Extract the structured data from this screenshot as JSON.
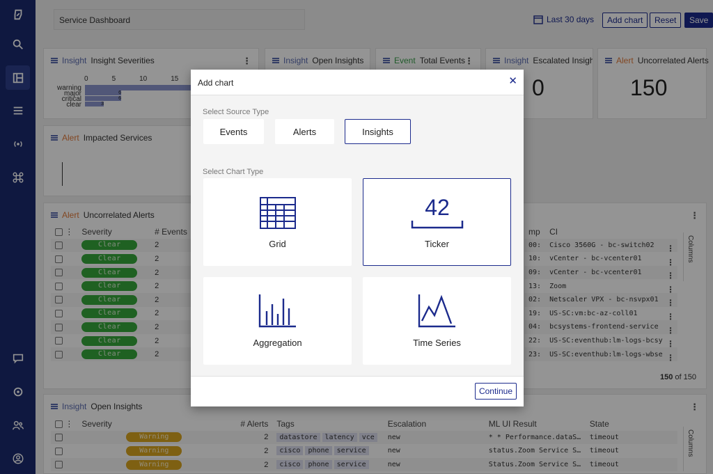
{
  "dashboard": {
    "title": "Service Dashboard",
    "date_range": "Last 30 days",
    "add_chart_label": "Add chart",
    "reset_label": "Reset",
    "save_label": "Save"
  },
  "widgets": {
    "insight_severities": {
      "tag": "Insight",
      "title": "Insight Severities",
      "ticks": [
        "0",
        "5",
        "10",
        "15"
      ],
      "bars": [
        {
          "label": "warning",
          "value": 150
        },
        {
          "label": "major",
          "value": 6
        },
        {
          "label": "critical",
          "value": 6
        },
        {
          "label": "clear",
          "value": 3
        }
      ]
    },
    "open_insights_small": {
      "tag": "Insight",
      "title": "Open Insights"
    },
    "total_events": {
      "tag": "Event",
      "title": "Total Events"
    },
    "escalated_insights": {
      "tag": "Insight",
      "title": "Escalated Insights",
      "value": "0"
    },
    "uncorrelated_small": {
      "tag": "Alert",
      "title": "Uncorrelated Alerts",
      "value": "150"
    },
    "impacted_services": {
      "tag": "Alert",
      "title": "Impacted Services"
    }
  },
  "uncorrelated_table": {
    "tag": "Alert",
    "title": "Uncorrelated Alerts",
    "headers": {
      "severity": "Severity",
      "events": "# Events",
      "timestamp": "mp",
      "ci": "CI"
    },
    "columns_label": "Columns",
    "rows": [
      {
        "severity": "Clear",
        "events": "2",
        "ts": "00:",
        "ci": "Cisco 3560G - bc-switch02"
      },
      {
        "severity": "Clear",
        "events": "2",
        "ts": "10:",
        "ci": "vCenter - bc-vcenter01"
      },
      {
        "severity": "Clear",
        "events": "2",
        "ts": "09:",
        "ci": "vCenter - bc-vcenter01"
      },
      {
        "severity": "Clear",
        "events": "2",
        "ts": "13:",
        "ci": "Zoom"
      },
      {
        "severity": "Clear",
        "events": "2",
        "ts": "02:",
        "ci": "Netscaler VPX - bc-nsvpx01"
      },
      {
        "severity": "Clear",
        "events": "2",
        "ts": "19:",
        "ci": "US-SC:vm:bc-az-coll01"
      },
      {
        "severity": "Clear",
        "events": "2",
        "ts": "04:",
        "ci": "bcsystems-frontend-service"
      },
      {
        "severity": "Clear",
        "events": "2",
        "ts": "22:",
        "ci": "US-SC:eventhub:lm-logs-bcsy"
      },
      {
        "severity": "Clear",
        "events": "2",
        "ts": "23:",
        "ci": "US-SC:eventhub:lm-logs-wbse"
      }
    ],
    "pager_bold": "150",
    "pager_rest": " of 150"
  },
  "open_insights_table": {
    "tag": "Insight",
    "title": "Open Insights",
    "headers": {
      "severity": "Severity",
      "alerts": "# Alerts",
      "tags": "Tags",
      "escalation": "Escalation",
      "ml": "ML UI Result",
      "state": "State"
    },
    "columns_label": "Columns",
    "rows": [
      {
        "severity": "Warning",
        "alerts": "2",
        "tags": [
          "datastore",
          "latency",
          "vce"
        ],
        "escalation": "new",
        "ml": "* * Performance.dataS…",
        "state": "timeout"
      },
      {
        "severity": "Warning",
        "alerts": "2",
        "tags": [
          "cisco",
          "phone",
          "service"
        ],
        "escalation": "new",
        "ml": "status.Zoom Service S…",
        "state": "timeout"
      },
      {
        "severity": "Warning",
        "alerts": "2",
        "tags": [
          "cisco",
          "phone",
          "service"
        ],
        "escalation": "new",
        "ml": "Status.Zoom Service S…",
        "state": "timeout"
      }
    ]
  },
  "modal": {
    "title": "Add chart",
    "source_label": "Select Source Type",
    "sources": [
      "Events",
      "Alerts",
      "Insights"
    ],
    "selected_source": "Insights",
    "chart_label": "Select Chart Type",
    "chart_types": [
      "Grid",
      "Ticker",
      "Aggregation",
      "Time Series"
    ],
    "selected_chart": "Ticker",
    "ticker_sample": "42",
    "continue_label": "Continue"
  },
  "colors": {
    "brand": "#1b2a8c",
    "sidebar": "#1b2a6e",
    "clear": "#36a83c",
    "warning": "#d9a520"
  }
}
